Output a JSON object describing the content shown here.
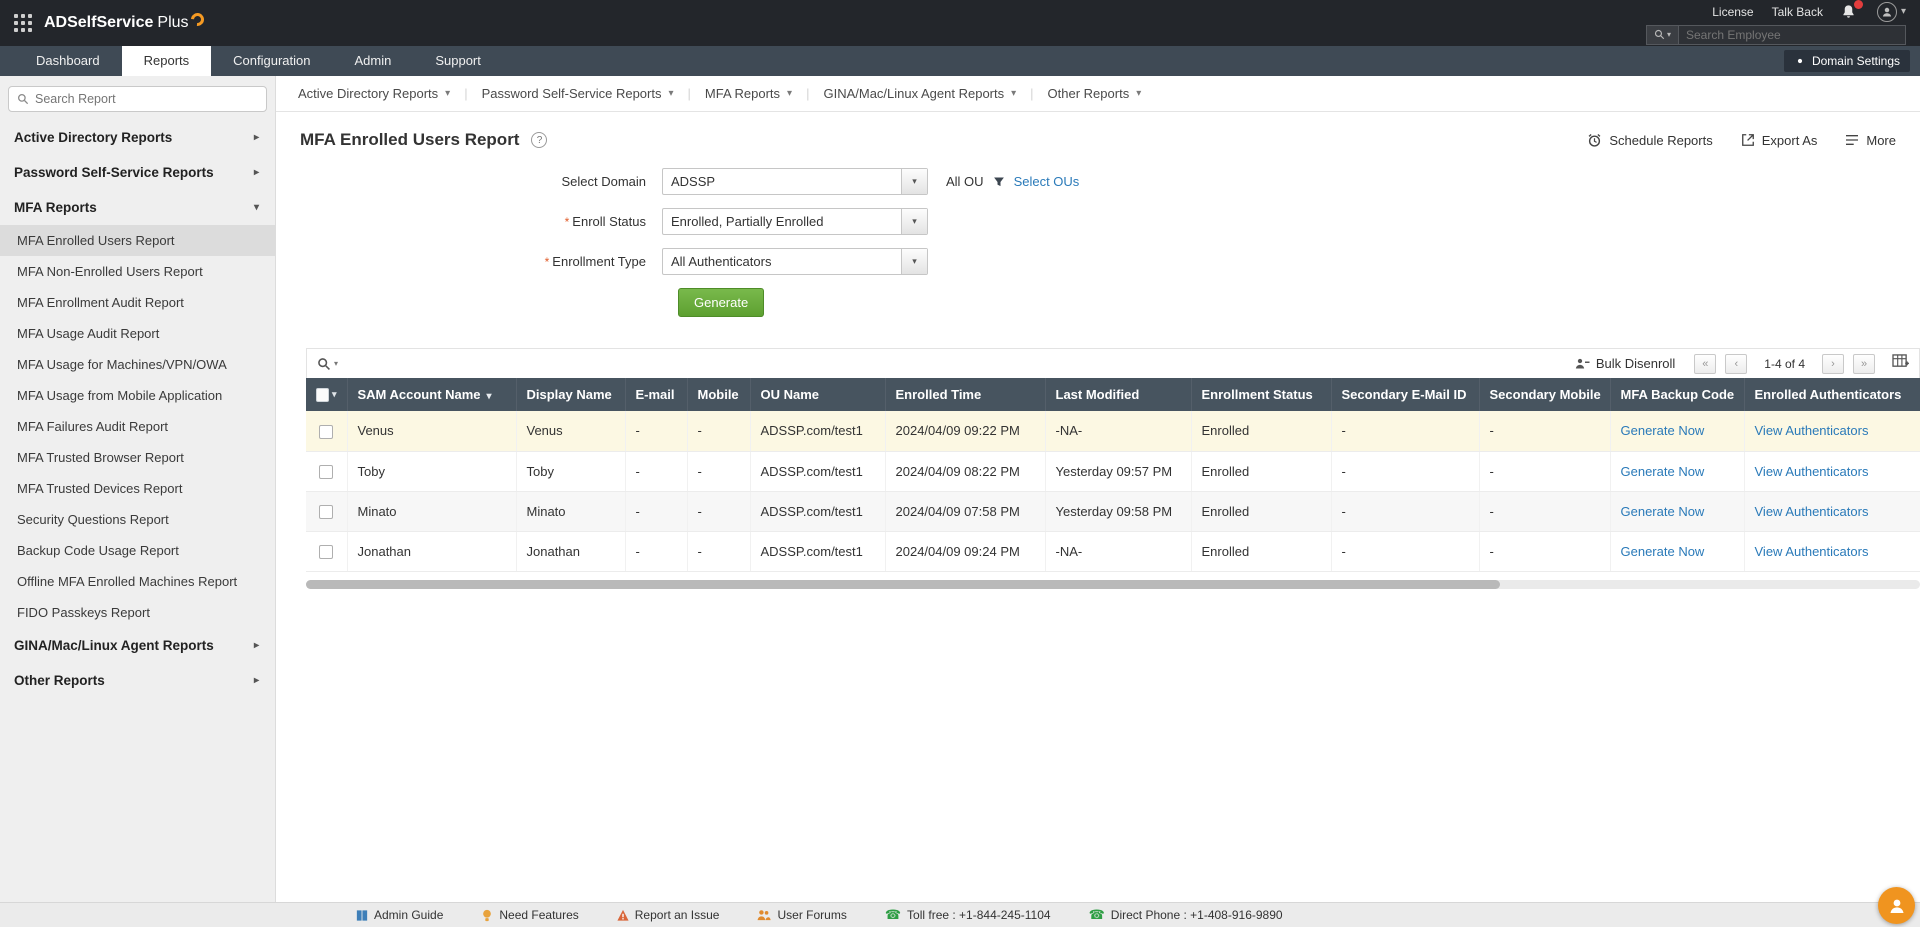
{
  "glyphs": {
    "caret_down": "▾",
    "chevron_right": "▸",
    "pipe": "|",
    "required": "*",
    "help": "?"
  },
  "colors": {
    "accent_green": "#5da030",
    "link_blue": "#2a7ab9",
    "table_header": "#47545f",
    "row_highlight": "#fcf8e3",
    "topbar": "#23262b"
  },
  "topbar": {
    "brand_name": "ADSelfService",
    "brand_suffix": "Plus",
    "license_label": "License",
    "talkback_label": "Talk Back",
    "search_placeholder": "Search Employee"
  },
  "nav": {
    "tabs": [
      {
        "label": "Dashboard"
      },
      {
        "label": "Reports"
      },
      {
        "label": "Configuration"
      },
      {
        "label": "Admin"
      },
      {
        "label": "Support"
      }
    ],
    "domain_settings_label": "Domain Settings"
  },
  "sidebar": {
    "search_placeholder": "Search Report",
    "section_ad": "Active Directory Reports",
    "section_pss": "Password Self-Service Reports",
    "section_mfa": "MFA Reports",
    "mfa_items": [
      "MFA Enrolled Users Report",
      "MFA Non-Enrolled Users Report",
      "MFA Enrollment Audit Report",
      "MFA Usage Audit Report",
      "MFA Usage for Machines/VPN/OWA",
      "MFA Usage from Mobile Application",
      "MFA Failures Audit Report",
      "MFA Trusted Browser Report",
      "MFA Trusted Devices Report",
      "Security Questions Report",
      "Backup Code Usage Report",
      "Offline MFA Enrolled Machines Report",
      "FIDO Passkeys Report"
    ],
    "section_gina": "GINA/Mac/Linux Agent Reports",
    "section_other": "Other Reports"
  },
  "menubar": {
    "items": [
      "Active Directory Reports",
      "Password Self-Service Reports",
      "MFA Reports",
      "GINA/Mac/Linux Agent Reports",
      "Other Reports"
    ]
  },
  "page": {
    "title": "MFA Enrolled Users Report",
    "schedule_label": "Schedule Reports",
    "export_label": "Export As",
    "more_label": "More"
  },
  "form": {
    "domain_label": "Select Domain",
    "domain_value": "ADSSP",
    "all_ou_label": "All OU",
    "select_ous_label": "Select OUs",
    "enroll_status_label": "Enroll Status",
    "enroll_status_value": "Enrolled, Partially Enrolled",
    "enrollment_type_label": "Enrollment Type",
    "enrollment_type_value": "All Authenticators",
    "generate_label": "Generate"
  },
  "table": {
    "bulk_disenroll_label": "Bulk Disenroll",
    "pagination": {
      "first": "«",
      "prev": "‹",
      "next": "›",
      "last": "»",
      "info": "1-4 of 4"
    },
    "columns": [
      "SAM Account Name",
      "Display Name",
      "E-mail",
      "Mobile",
      "OU Name",
      "Enrolled Time",
      "Last Modified",
      "Enrollment Status",
      "Secondary E-Mail ID",
      "Secondary Mobile",
      "MFA Backup Code",
      "Enrolled Authenticators"
    ],
    "rows": [
      {
        "sam": "Venus",
        "display": "Venus",
        "email": "-",
        "mobile": "-",
        "ou": "ADSSP.com/test1",
        "enrolled": "2024/04/09 09:22 PM",
        "modified": "-NA-",
        "status": "Enrolled",
        "sec_email": "-",
        "sec_mobile": "-",
        "backup": "Generate Now",
        "auth": "View Authenticators"
      },
      {
        "sam": "Toby",
        "display": "Toby",
        "email": "-",
        "mobile": "-",
        "ou": "ADSSP.com/test1",
        "enrolled": "2024/04/09 08:22 PM",
        "modified": "Yesterday 09:57 PM",
        "status": "Enrolled",
        "sec_email": "-",
        "sec_mobile": "-",
        "backup": "Generate Now",
        "auth": "View Authenticators"
      },
      {
        "sam": "Minato",
        "display": "Minato",
        "email": "-",
        "mobile": "-",
        "ou": "ADSSP.com/test1",
        "enrolled": "2024/04/09 07:58 PM",
        "modified": "Yesterday 09:58 PM",
        "status": "Enrolled",
        "sec_email": "-",
        "sec_mobile": "-",
        "backup": "Generate Now",
        "auth": "View Authenticators"
      },
      {
        "sam": "Jonathan",
        "display": "Jonathan",
        "email": "-",
        "mobile": "-",
        "ou": "ADSSP.com/test1",
        "enrolled": "2024/04/09 09:24 PM",
        "modified": "-NA-",
        "status": "Enrolled",
        "sec_email": "-",
        "sec_mobile": "-",
        "backup": "Generate Now",
        "auth": "View Authenticators"
      }
    ]
  },
  "footer": {
    "admin_guide": "Admin Guide",
    "need_features": "Need Features",
    "report_issue": "Report an Issue",
    "user_forums": "User Forums",
    "toll_free": "Toll free : +1-844-245-1104",
    "direct_phone": "Direct Phone : +1-408-916-9890"
  }
}
